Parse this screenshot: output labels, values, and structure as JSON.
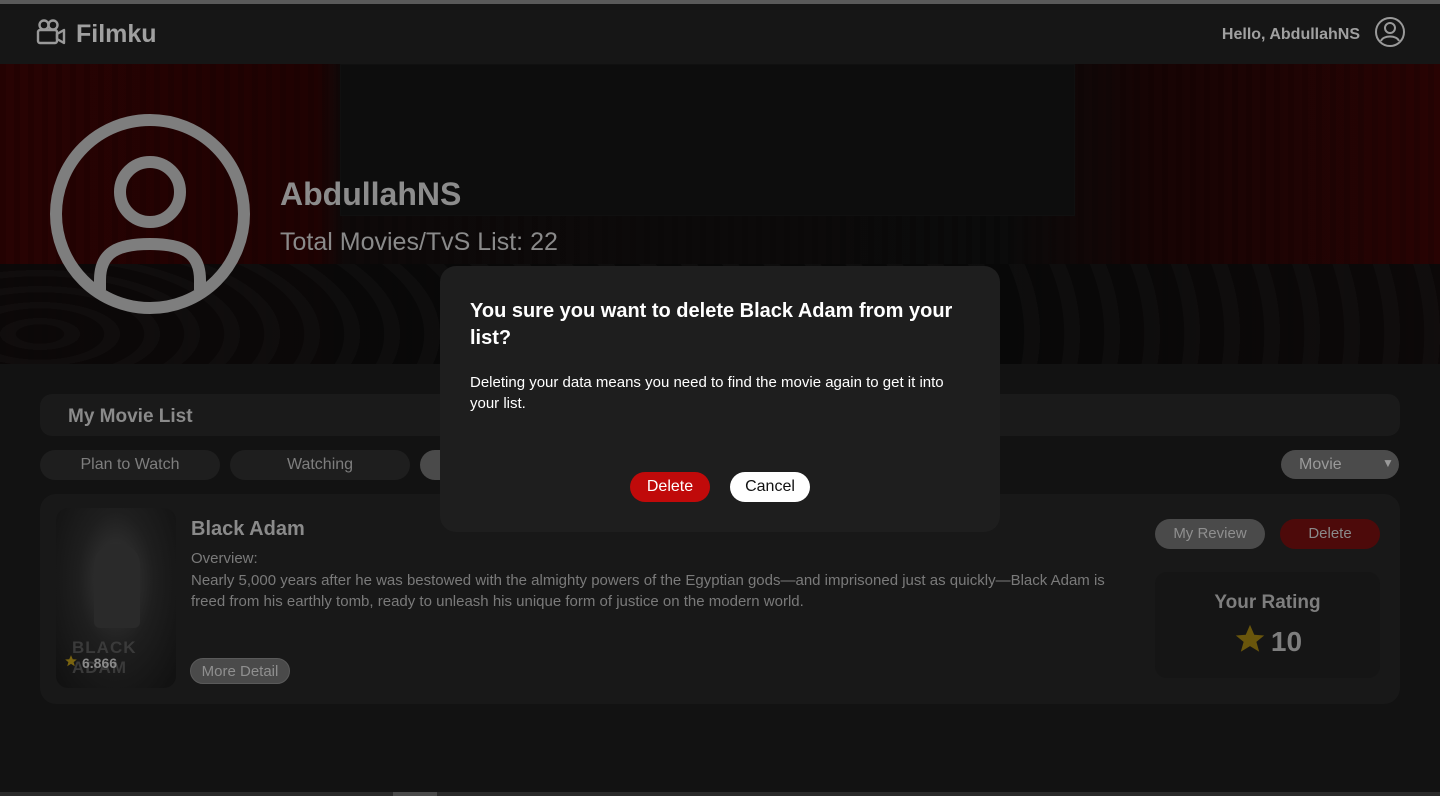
{
  "nav": {
    "brand": "Filmku",
    "greeting": "Hello, AbdullahNS"
  },
  "profile": {
    "username": "AbdullahNS",
    "total_label": "Total Movies/TvS List: 22"
  },
  "list": {
    "title": "My Movie List",
    "tabs": [
      {
        "label": "Plan to Watch"
      },
      {
        "label": "Watching"
      },
      {
        "label": ""
      }
    ],
    "type_select": {
      "selected": "Movie"
    }
  },
  "movie": {
    "title": "Black Adam",
    "overview_label": "Overview:",
    "overview": "Nearly 5,000 years after he was bestowed with the almighty powers of the Egyptian gods—and imprisoned just as quickly—Black Adam is freed from his earthly tomb, ready to unleash his unique form of justice on the modern world.",
    "poster_text": "BLACK ADAM",
    "score": "6.866",
    "more_label": "More Detail",
    "review_label": "My Review",
    "delete_label": "Delete",
    "your_rating_label": "Your Rating",
    "your_rating_value": "10"
  },
  "modal": {
    "title": "You sure you want to delete Black Adam from your list?",
    "body": "Deleting your data means you need to find the movie again to get it into your list.",
    "delete_label": "Delete",
    "cancel_label": "Cancel"
  },
  "colors": {
    "accent_red": "#c00a0a",
    "star_gold": "#b8860b",
    "background": "#121212"
  }
}
